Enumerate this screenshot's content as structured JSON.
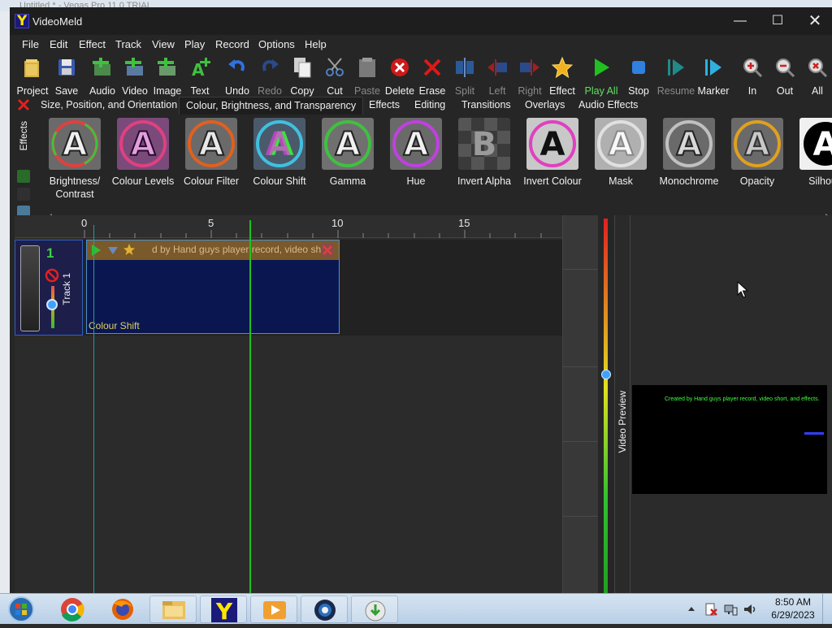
{
  "background_window": {
    "title": "Untitled * - Vegas Pro 11.0 TRIAL"
  },
  "window": {
    "title": "VideoMeld",
    "minimize": "—",
    "maximize": "☐",
    "close": "✕"
  },
  "menu": [
    {
      "label": "File"
    },
    {
      "label": "Edit"
    },
    {
      "label": "Effect"
    },
    {
      "label": "Track"
    },
    {
      "label": "View"
    },
    {
      "label": "Play"
    },
    {
      "label": "Record"
    },
    {
      "label": "Options"
    },
    {
      "label": "Help"
    }
  ],
  "toolbar": [
    {
      "label": "Project",
      "icon": "folder-icon",
      "enabled": true
    },
    {
      "label": "Save",
      "icon": "save-icon",
      "enabled": true
    },
    {
      "label": "Audio",
      "icon": "add-audio-icon",
      "enabled": true
    },
    {
      "label": "Video",
      "icon": "add-video-icon",
      "enabled": true
    },
    {
      "label": "Image",
      "icon": "add-image-icon",
      "enabled": true
    },
    {
      "label": "Text",
      "icon": "add-text-icon",
      "enabled": true
    },
    {
      "label": "Undo",
      "icon": "undo-icon",
      "enabled": true
    },
    {
      "label": "Redo",
      "icon": "redo-icon",
      "enabled": false
    },
    {
      "label": "Copy",
      "icon": "copy-icon",
      "enabled": true
    },
    {
      "label": "Cut",
      "icon": "scissors-icon",
      "enabled": true
    },
    {
      "label": "Paste",
      "icon": "paste-icon",
      "enabled": false
    },
    {
      "label": "Delete",
      "icon": "delete-icon",
      "enabled": true
    },
    {
      "label": "Erase",
      "icon": "erase-icon",
      "enabled": true
    },
    {
      "label": "Split",
      "icon": "split-icon",
      "enabled": false
    },
    {
      "label": "Left",
      "icon": "trim-left-icon",
      "enabled": false
    },
    {
      "label": "Right",
      "icon": "trim-right-icon",
      "enabled": false
    },
    {
      "label": "Effect",
      "icon": "star-icon",
      "enabled": true
    },
    {
      "label": "Play All",
      "icon": "play-icon",
      "enabled": true
    },
    {
      "label": "Stop",
      "icon": "stop-icon",
      "enabled": true
    },
    {
      "label": "Resume",
      "icon": "resume-icon",
      "enabled": false
    },
    {
      "label": "Marker",
      "icon": "marker-icon",
      "enabled": true
    },
    {
      "label": "In",
      "icon": "zoom-in-icon",
      "enabled": true
    },
    {
      "label": "Out",
      "icon": "zoom-out-icon",
      "enabled": true
    },
    {
      "label": "All",
      "icon": "zoom-all-icon",
      "enabled": true
    }
  ],
  "effect_tabs": [
    {
      "label": "Size, Position, and Orientation",
      "active": false
    },
    {
      "label": "Colour, Brightness, and Transparency",
      "active": true
    },
    {
      "label": "Effects",
      "active": false
    },
    {
      "label": "Editing",
      "active": false
    },
    {
      "label": "Transitions",
      "active": false
    },
    {
      "label": "Overlays",
      "active": false
    },
    {
      "label": "Audio Effects",
      "active": false
    }
  ],
  "effects_panel_label": "Effects",
  "effects": [
    {
      "label": "Brightness/ Contrast",
      "thumb": "A"
    },
    {
      "label": "Colour Levels",
      "thumb": "A"
    },
    {
      "label": "Colour Filter",
      "thumb": "A"
    },
    {
      "label": "Colour Shift",
      "thumb": "A"
    },
    {
      "label": "Gamma",
      "thumb": "A"
    },
    {
      "label": "Hue",
      "thumb": "A"
    },
    {
      "label": "Invert Alpha",
      "thumb": "B"
    },
    {
      "label": "Invert Colour",
      "thumb": "A"
    },
    {
      "label": "Mask",
      "thumb": "A"
    },
    {
      "label": "Monochrome",
      "thumb": "A"
    },
    {
      "label": "Opacity",
      "thumb": "A"
    },
    {
      "label": "Silhoue",
      "thumb": "A"
    }
  ],
  "timeline": {
    "ruler_ticks": [
      "0",
      "5",
      "10",
      "15"
    ],
    "track": {
      "number": "1",
      "label": "Track 1"
    },
    "clip": {
      "title": "d by Hand guys player record, video sh",
      "effect_label": "Colour Shift"
    }
  },
  "preview": {
    "label": "Video Preview",
    "caption": "Created by Hand guys player record, video short, and effects."
  },
  "taskbar": {
    "apps": [
      {
        "name": "chrome-icon"
      },
      {
        "name": "firefox-icon"
      },
      {
        "name": "explorer-icon"
      },
      {
        "name": "videomeld-icon"
      },
      {
        "name": "media-player-icon"
      },
      {
        "name": "camera-app-icon"
      },
      {
        "name": "installer-icon"
      }
    ],
    "time": "8:50 AM",
    "date": "6/29/2023"
  },
  "colors": {
    "accent": "#3060c0",
    "playhead": "#20c020",
    "clip_bg": "#0a1650",
    "clip_bar": "#7a5a2a"
  }
}
